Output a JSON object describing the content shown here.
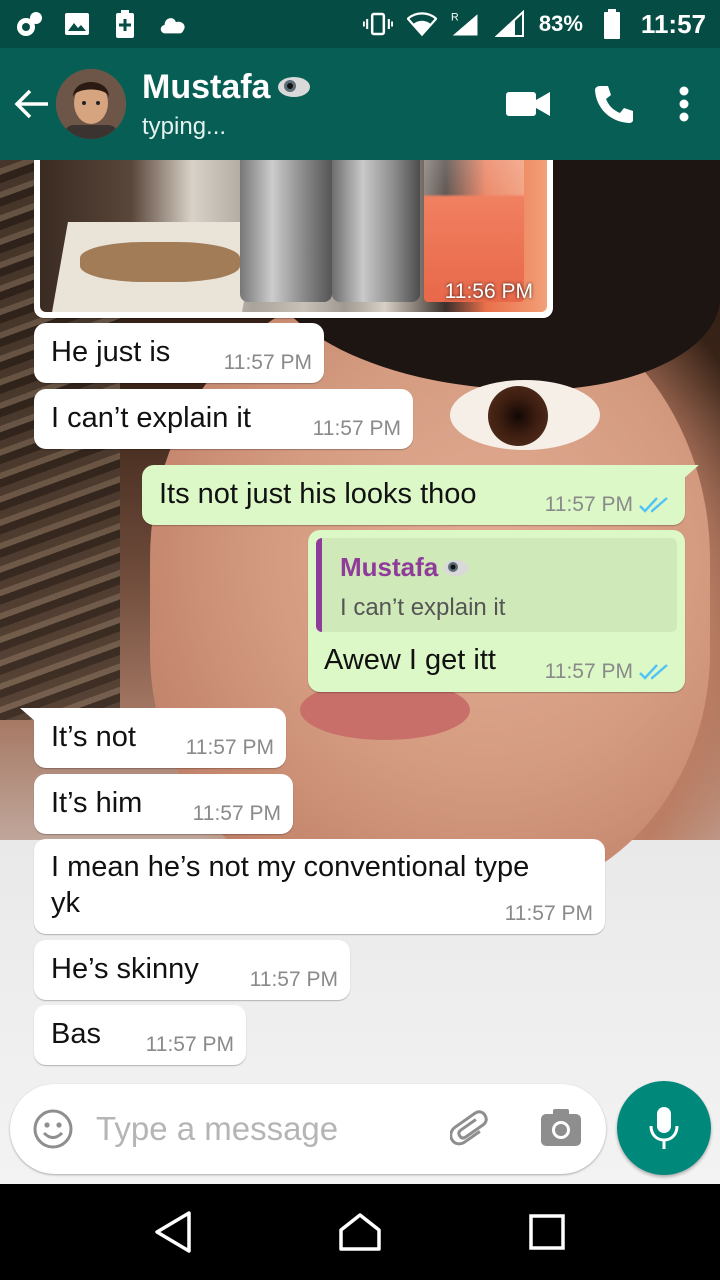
{
  "status_bar": {
    "battery_percent": "83%",
    "time": "11:57",
    "roaming_label": "R",
    "icons": [
      "app-notification-icon",
      "gallery-icon",
      "battery-saver-icon",
      "cloud-icon",
      "vibrate-icon",
      "wifi-icon",
      "signal-icon",
      "battery-icon"
    ]
  },
  "header": {
    "contact_name": "Mustafa",
    "contact_status": "typing...",
    "colors": {
      "bar": "#075e54",
      "status_bar": "#054d44"
    }
  },
  "chat": {
    "image_message": {
      "time": "11:56 PM"
    },
    "messages": [
      {
        "text": "He just is",
        "time": "11:57 PM",
        "direction": "in"
      },
      {
        "text": "I can’t explain it",
        "time": "11:57 PM",
        "direction": "in"
      },
      {
        "text": "Its not just his looks thoo",
        "time": "11:57 PM",
        "direction": "out",
        "read": true
      },
      {
        "text": "Awew I get itt",
        "time": "11:57 PM",
        "direction": "out",
        "read": true,
        "quote": {
          "author": "Mustafa",
          "text": "I can’t explain it"
        }
      },
      {
        "text": "It’s not",
        "time": "11:57 PM",
        "direction": "in"
      },
      {
        "text": "It’s him",
        "time": "11:57 PM",
        "direction": "in"
      },
      {
        "line1": "I mean he’s not my conventional type",
        "line2": "yk",
        "time": "11:57 PM",
        "direction": "in"
      },
      {
        "text": "He’s skinny",
        "time": "11:57 PM",
        "direction": "in"
      },
      {
        "text": "Bas",
        "time": "11:57 PM",
        "direction": "in"
      }
    ],
    "colors": {
      "incoming": "#ffffff",
      "outgoing": "#dcf8c6",
      "read_ticks": "#4fc3f7",
      "quote_author": "#8e3b9a"
    }
  },
  "composer": {
    "placeholder": "Type a message",
    "value": "",
    "mic_color": "#00897b"
  }
}
